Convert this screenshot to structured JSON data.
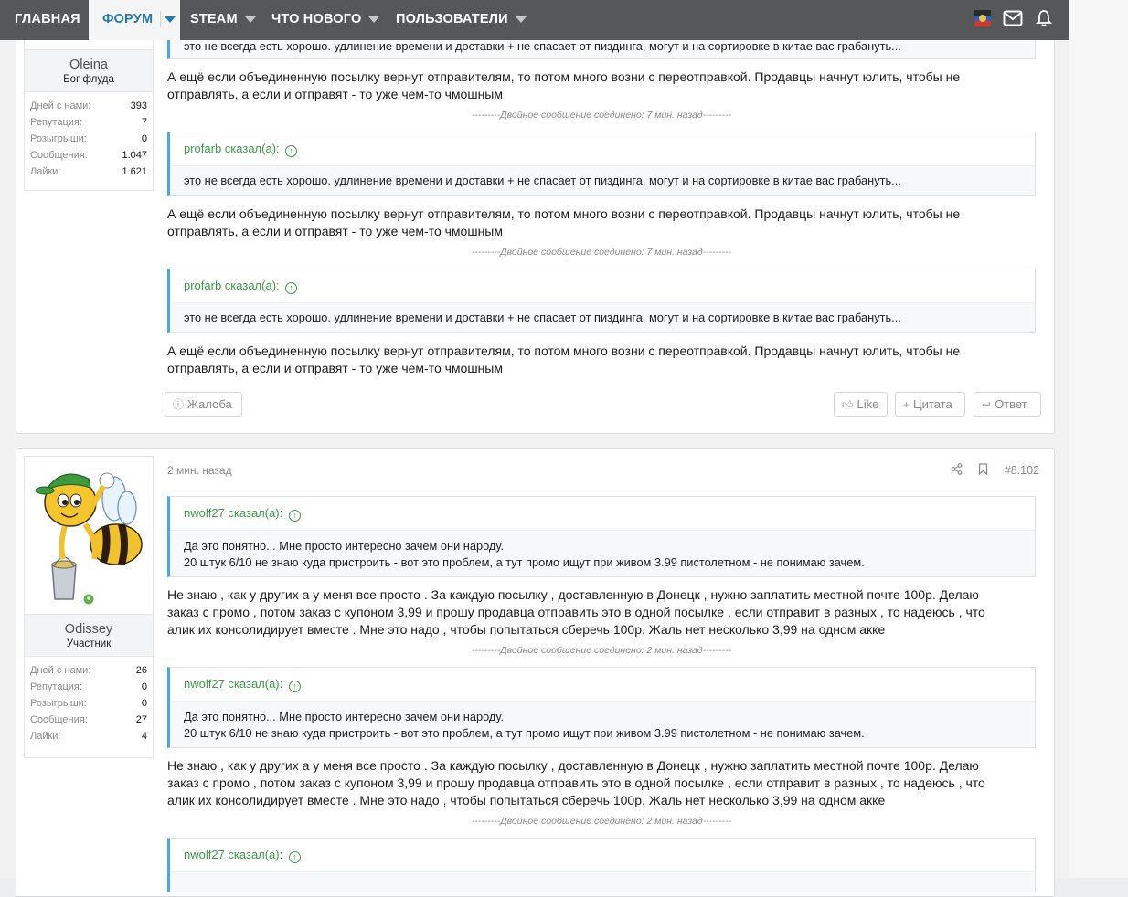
{
  "nav": {
    "items": [
      {
        "label": "ГЛАВНАЯ"
      },
      {
        "label": "ФОРУМ"
      },
      {
        "label": "STEAM"
      },
      {
        "label": "ЧТО НОВОГО"
      },
      {
        "label": "ПОЛЬЗОВАТЕЛИ"
      }
    ],
    "icons": [
      "flag-avatar-icon",
      "mail-icon",
      "bell-icon"
    ]
  },
  "post1": {
    "user": {
      "name": "Oleina",
      "title": "Бог флуда",
      "stats": [
        {
          "k": "Дней с нами:",
          "v": "393"
        },
        {
          "k": "Репутация:",
          "v": "7"
        },
        {
          "k": "Розыгрыши:",
          "v": "0"
        },
        {
          "k": "Сообщения:",
          "v": "1.047"
        },
        {
          "k": "Лайки:",
          "v": "1.621"
        }
      ]
    },
    "top_quote_tail": "это не всегда есть хорошо. удлинение времени и доставки + не спасает от пиздинга, могут и на сортировке в китае вас грабануть...",
    "reply_line1": "А ещё если объединенную посылку вернут отправителям, то потом много возни с переотправкой. Продавцы начнут юлить, чтобы не",
    "reply_line2": "отправлять, а если и отправят - то уже чем-то чмошным",
    "merged": "---------Двойное сообщение соединено: 7 мин. назад---------",
    "quote_author": "profarb сказал(а):",
    "quote_text": "это не всегда есть хорошо. удлинение времени и доставки + не спасает от пиздинга, могут и на сортировке в китае вас грабануть...",
    "buttons": {
      "report": "Жалоба",
      "like": "Like",
      "quote": "Цитата",
      "reply": "Ответ"
    }
  },
  "post2": {
    "time": "2 мин. назад",
    "number": "#8.102",
    "user": {
      "name": "Odissey",
      "title": "Участник",
      "stats": [
        {
          "k": "Дней с нами:",
          "v": "26"
        },
        {
          "k": "Репутация:",
          "v": "0"
        },
        {
          "k": "Розыгрыши:",
          "v": "0"
        },
        {
          "k": "Сообщения:",
          "v": "27"
        },
        {
          "k": "Лайки:",
          "v": "4"
        }
      ]
    },
    "quote_author": "nwolf27 сказал(а):",
    "quote_line1": "Да это понятно... Мне просто интересно зачем они народу.",
    "quote_line2": "20 штук 6/10 не знаю куда пристроить - вот это проблем, а тут промо ищут при живом 3.99 пистолетном - не понимаю зачем.",
    "reply_line1": "Не знаю , как у других а у меня все просто . За каждую посылку , доставленную в Донецк , нужно заплатить местной почте 100р. Делаю",
    "reply_line2": "заказ с промо , потом заказ с купоном 3,99 и прошу продавца отправить это в одной посылке , если отправит в разных , то надеюсь , что",
    "reply_line3": "алик их консолидирует вместе . Мне это надо , чтобы попытаться сберечь 100р. Жаль нет несколько 3,99 на одном акке",
    "merged": "---------Двойное сообщение соединено: 2 мин. назад---------"
  }
}
